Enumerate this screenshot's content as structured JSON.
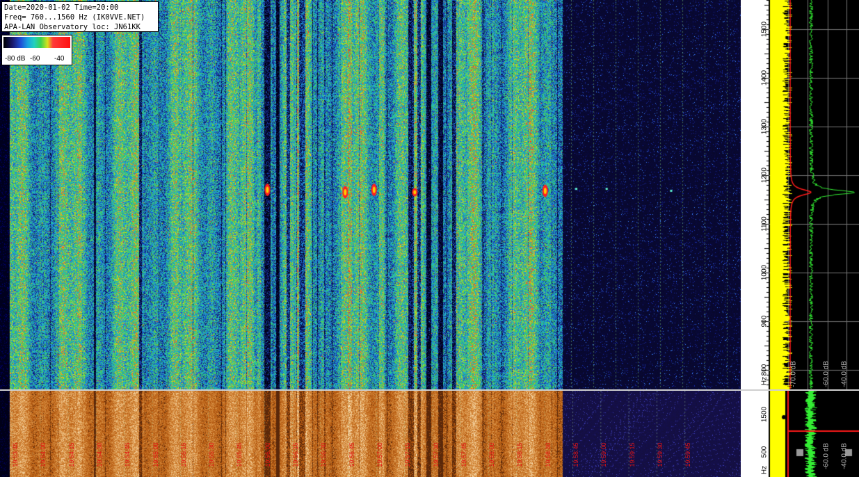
{
  "header": {
    "line1": "Date=2020-01-02 Time=20:00",
    "line2": "Freq= 760...1560 Hz (IK0VVE.NET)",
    "line3": "APA-LAN Observatory loc: JN61KK"
  },
  "color_scale": {
    "labels": [
      "-80 dB",
      "-60",
      "-40"
    ]
  },
  "colors": {
    "background": "#000000",
    "trace_yellow": "#ffff00",
    "trace_green": "#33ee33",
    "trace_red": "#ff1a1a",
    "label_red": "#e41414"
  },
  "chart_data": [
    {
      "type": "heatmap",
      "name_hint": "main-spectrogram",
      "ylabel": "Hz",
      "ylim": [
        760,
        1560
      ],
      "y_ticks": [
        800,
        900,
        1000,
        1100,
        1200,
        1300,
        1400,
        1500
      ],
      "y_tick_labels": [
        "800",
        "900",
        "1000",
        "1100",
        "1200",
        "1300",
        "1400",
        "1500"
      ],
      "y_unit_label": "Hz",
      "active_fraction": 0.76,
      "peak_freq": 1170,
      "signal_events": [
        {
          "t_frac": 0.361,
          "freq": 1170,
          "strength": "strong"
        },
        {
          "t_frac": 0.466,
          "freq": 1165,
          "strength": "strong"
        },
        {
          "t_frac": 0.505,
          "freq": 1170,
          "strength": "strong"
        },
        {
          "t_frac": 0.56,
          "freq": 1165,
          "strength": "medium"
        },
        {
          "t_frac": 0.736,
          "freq": 1168,
          "strength": "strong"
        },
        {
          "t_frac": 0.778,
          "freq": 1172,
          "strength": "weak"
        },
        {
          "t_frac": 0.819,
          "freq": 1172,
          "strength": "weak"
        },
        {
          "t_frac": 0.906,
          "freq": 1168,
          "strength": "weak"
        }
      ]
    },
    {
      "type": "line",
      "name_hint": "spectrum-profile",
      "x_tick_labels": [
        "-70.0 dB",
        "-60.0 dB",
        "-40.0 dB"
      ],
      "series": [
        {
          "color": "yellow",
          "level": "-70.0 dB"
        },
        {
          "color": "green",
          "level": "-60.0 dB",
          "peak_freq": 1165
        },
        {
          "color": "red",
          "level": "-70.0 dB",
          "peak_freq": 1165
        }
      ]
    },
    {
      "type": "heatmap",
      "name_hint": "lower-spectrogram",
      "time_labels": [
        "19:53:45",
        "19:54:00",
        "19:54:15",
        "19:54:30",
        "19:54:45",
        "19:55:00",
        "19:55:15",
        "19:55:30",
        "19:55:45",
        "19:56:00",
        "19:56:15",
        "19:56:30",
        "19:56:45",
        "19:57:00",
        "19:57:15",
        "19:57:30",
        "19:57:45",
        "19:58:00",
        "19:58:15",
        "19:58:30",
        "19:58:45",
        "19:59:00",
        "19:59:15",
        "19:59:30",
        "19:59:45"
      ],
      "y_tick_labels": [
        "1500",
        "500"
      ],
      "y_unit_label": "Hz",
      "x_tick_labels": [
        "-60.0 dB",
        "-40.0 dB"
      ]
    }
  ]
}
